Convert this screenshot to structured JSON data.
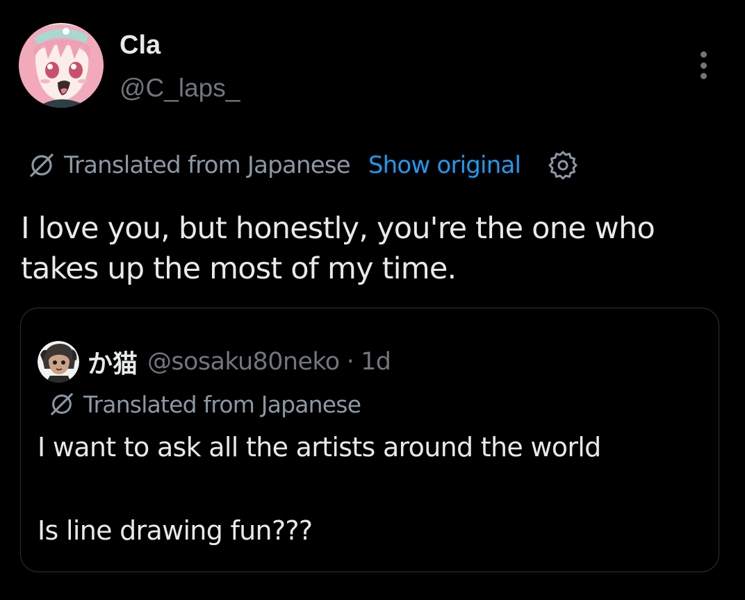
{
  "tweet": {
    "author": {
      "display_name": "Cla",
      "handle": "@C_laps_",
      "avatar_icon": "anime-girl-avatar"
    },
    "translation": {
      "label": "Translated from Japanese",
      "show_original": "Show original",
      "settings_icon": "gear-icon"
    },
    "text": "I love you, but honestly, you're the one who\ntakes up the most of my time.",
    "more_icon": "vertical-ellipsis-icon"
  },
  "quote": {
    "author": {
      "display_name": "か猫",
      "handle": "@sosaku80neko",
      "separator": "·",
      "time": "1d",
      "avatar_icon": "anime-character-avatar"
    },
    "translation": {
      "label": "Translated from Japanese"
    },
    "text": "I want to ask all the artists around the world\n\nIs line drawing fun???"
  },
  "colors": {
    "background": "#000000",
    "primary_text": "#e7e9ea",
    "secondary_text": "#71767b",
    "translate_text": "#8b98a5",
    "accent": "#1d9bf0",
    "border": "#2f3336"
  }
}
